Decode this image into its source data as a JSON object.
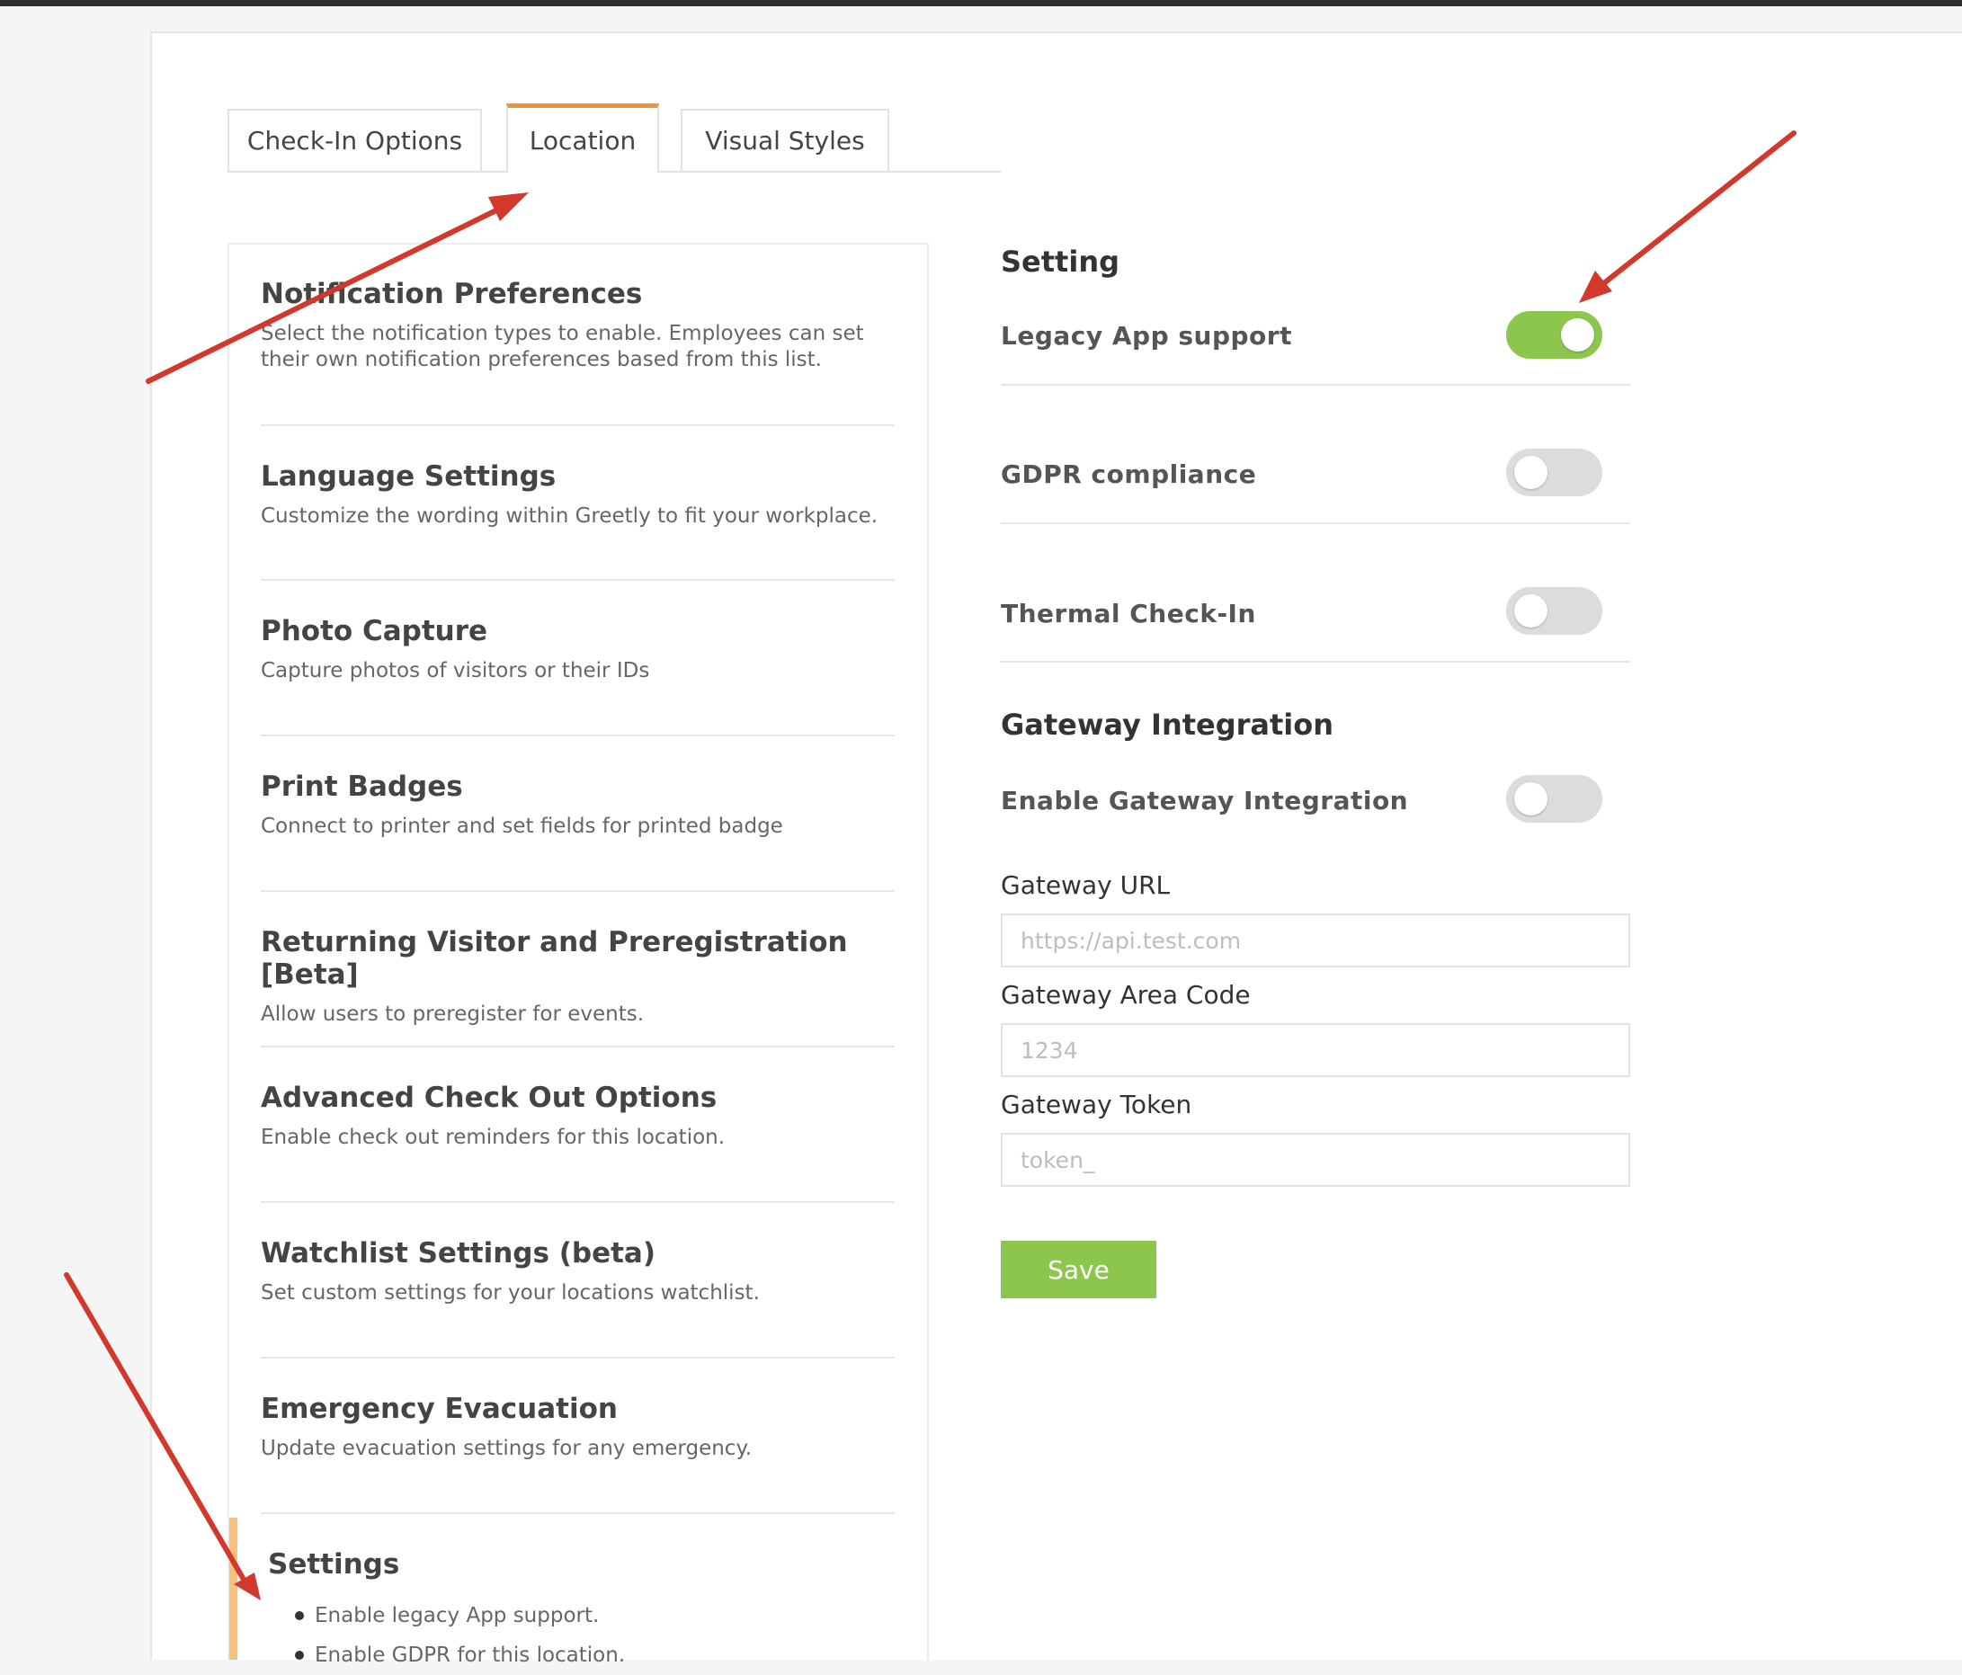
{
  "tabs": [
    {
      "label": "Check-In Options",
      "active": false
    },
    {
      "label": "Location",
      "active": true
    },
    {
      "label": "Visual Styles",
      "active": false
    }
  ],
  "menu": {
    "items": [
      {
        "title": "Notification Preferences",
        "desc": "Select the notification types to enable. Employees can set their own notification preferences based from this list."
      },
      {
        "title": "Language Settings",
        "desc": "Customize the wording within Greetly to fit your workplace."
      },
      {
        "title": "Photo Capture",
        "desc": "Capture photos of visitors or their IDs"
      },
      {
        "title": "Print Badges",
        "desc": "Connect to printer and set fields for printed badge"
      },
      {
        "title": "Returning Visitor and Preregistration [Beta]",
        "desc": "Allow users to preregister for events."
      },
      {
        "title": "Advanced Check Out Options",
        "desc": "Enable check out reminders for this location."
      },
      {
        "title": "Watchlist Settings (beta)",
        "desc": "Set custom settings for your locations watchlist."
      },
      {
        "title": "Emergency Evacuation",
        "desc": "Update evacuation settings for any emergency."
      }
    ],
    "active": {
      "title": "Settings",
      "bullets": [
        "Enable legacy App support.",
        "Enable GDPR for this location."
      ]
    }
  },
  "settings": {
    "heading": "Setting",
    "rows": [
      {
        "label": "Legacy App support",
        "on": true
      },
      {
        "label": "GDPR compliance",
        "on": false
      },
      {
        "label": "Thermal Check-In",
        "on": false
      }
    ]
  },
  "gateway": {
    "heading": "Gateway Integration",
    "toggle_label": "Enable Gateway Integration",
    "toggle_on": false,
    "url_label": "Gateway URL",
    "url_placeholder": "https://api.test.com",
    "area_label": "Gateway Area Code",
    "area_placeholder": "1234",
    "token_label": "Gateway Token",
    "token_placeholder": "token_"
  },
  "save_label": "Save",
  "colors": {
    "accent": "#f0923b",
    "toggle_on": "#8dc64d",
    "toggle_off": "#dcdcdc",
    "annotation_arrow": "#d0392b"
  }
}
